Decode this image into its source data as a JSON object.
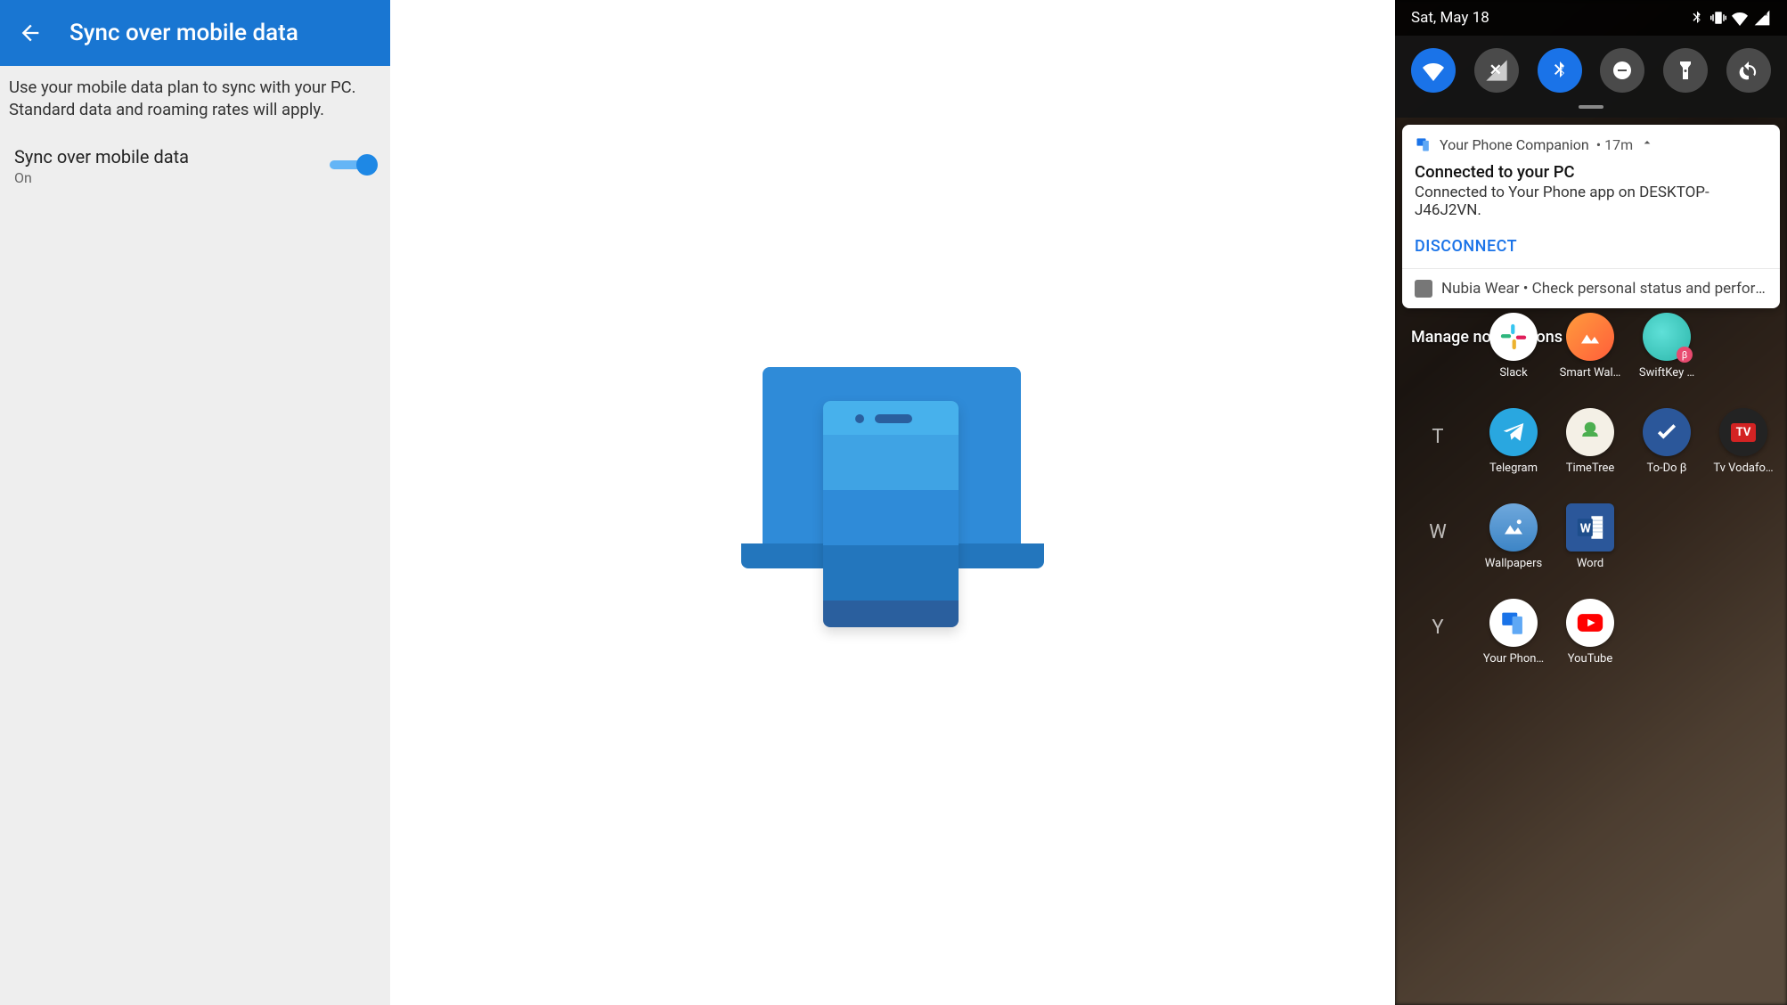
{
  "left": {
    "title": "Sync over mobile data",
    "description": "Use your mobile data plan to sync with your PC. Standard data and roaming rates will apply.",
    "setting_label": "Sync over mobile data",
    "setting_state": "On"
  },
  "shade": {
    "status": {
      "date": "Sat, May 18"
    },
    "quick_settings": [
      {
        "id": "wifi",
        "name": "Wi-Fi",
        "active": true
      },
      {
        "id": "cellular",
        "name": "Mobile data",
        "active": false
      },
      {
        "id": "bluetooth",
        "name": "Bluetooth",
        "active": true
      },
      {
        "id": "dnd",
        "name": "Do Not Disturb",
        "active": false
      },
      {
        "id": "flashlight",
        "name": "Flashlight",
        "active": false
      },
      {
        "id": "rotate",
        "name": "Auto-rotate",
        "active": false
      }
    ],
    "notification1": {
      "app_name": "Your Phone Companion",
      "time": "17m",
      "title": "Connected to your PC",
      "text": "Connected to Your Phone app on DESKTOP-J46J2VN.",
      "action": "DISCONNECT"
    },
    "notification2": {
      "app_name": "Nubia Wear",
      "text": "Check personal status and perform settings of…"
    },
    "manage_label": "Manage notifications",
    "app_rows": [
      {
        "letter": "",
        "apps": [
          {
            "id": "slack",
            "label": "Slack"
          },
          {
            "id": "smartwall",
            "label": "Smart Wal…"
          },
          {
            "id": "swiftkey",
            "label": "SwiftKey …"
          }
        ]
      },
      {
        "letter": "T",
        "apps": [
          {
            "id": "telegram",
            "label": "Telegram"
          },
          {
            "id": "timetree",
            "label": "TimeTree"
          },
          {
            "id": "todo",
            "label": "To-Do β"
          },
          {
            "id": "tvvod",
            "label": "Tv Vodafo…"
          }
        ]
      },
      {
        "letter": "W",
        "apps": [
          {
            "id": "wallpapers",
            "label": "Wallpapers"
          },
          {
            "id": "word",
            "label": "Word"
          }
        ]
      },
      {
        "letter": "Y",
        "apps": [
          {
            "id": "yourphone",
            "label": "Your Phon…"
          },
          {
            "id": "youtube",
            "label": "YouTube"
          }
        ]
      }
    ]
  }
}
